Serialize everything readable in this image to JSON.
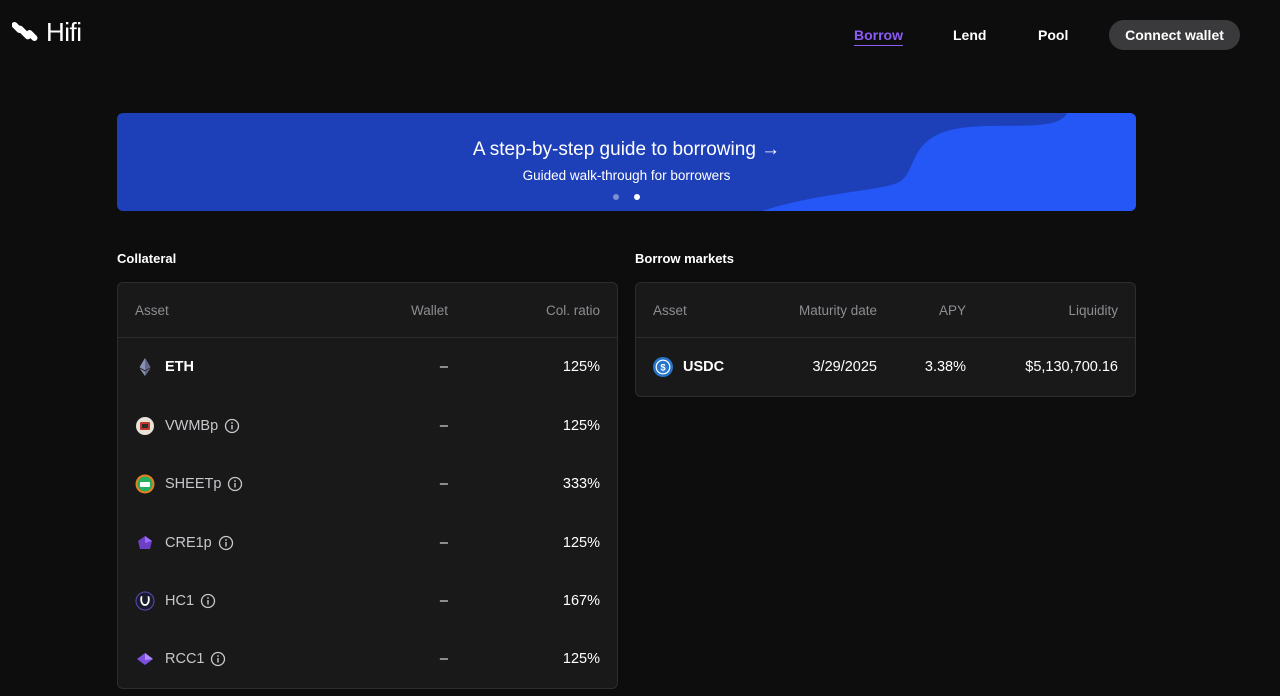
{
  "header": {
    "logo_text": "Hifi",
    "nav": [
      {
        "label": "Borrow",
        "active": true
      },
      {
        "label": "Lend",
        "active": false
      },
      {
        "label": "Pool",
        "active": false
      }
    ],
    "connect_wallet": "Connect wallet"
  },
  "banner": {
    "title": "A step-by-step guide to borrowing →",
    "subtitle": "Guided walk-through for borrowers",
    "slides": 2,
    "active_slide": 2
  },
  "collateral": {
    "title": "Collateral",
    "headers": [
      "Asset",
      "Wallet",
      "Col. ratio"
    ],
    "rows": [
      {
        "asset": "ETH",
        "icon": "eth-icon",
        "wallet": "–",
        "ratio": "125%",
        "info": false
      },
      {
        "asset": "VWMBp",
        "icon": "vwmbp-icon",
        "wallet": "–",
        "ratio": "125%",
        "info": true
      },
      {
        "asset": "SHEETp",
        "icon": "sheetp-icon",
        "wallet": "–",
        "ratio": "333%",
        "info": true
      },
      {
        "asset": "CRE1p",
        "icon": "cre1p-icon",
        "wallet": "–",
        "ratio": "125%",
        "info": true
      },
      {
        "asset": "HC1",
        "icon": "hc1-icon",
        "wallet": "–",
        "ratio": "167%",
        "info": true
      },
      {
        "asset": "RCC1",
        "icon": "rcc1-icon",
        "wallet": "–",
        "ratio": "125%",
        "info": true
      }
    ]
  },
  "markets": {
    "title": "Borrow markets",
    "headers": [
      "Asset",
      "Maturity date",
      "APY",
      "Liquidity"
    ],
    "rows": [
      {
        "asset": "USDC",
        "icon": "usdc-icon",
        "maturity": "3/29/2025",
        "apy": "3.38%",
        "liquidity": "$5,130,700.16"
      }
    ]
  },
  "colors": {
    "accent": "#8b5cf6",
    "banner_bg": "#1d3fb8",
    "banner_wave": "#2457f5",
    "page_bg": "#0d0d0e",
    "panel_bg": "#19191a"
  }
}
